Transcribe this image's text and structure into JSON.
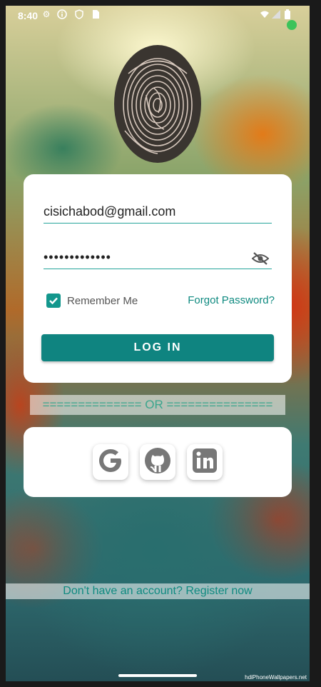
{
  "status_bar": {
    "time": "8:40",
    "left_icons": [
      "settings-icon",
      "info-icon",
      "shield-icon",
      "sim-icon"
    ],
    "right_icons": [
      "wifi-icon",
      "signal-icon",
      "battery-icon"
    ],
    "indicator_color": "#3cc35a"
  },
  "login": {
    "email_value": "cisichabod@gmail.com",
    "password_value": "•••••••••••••",
    "remember_label": "Remember Me",
    "remember_checked": true,
    "forgot_label": "Forgot Password?",
    "login_button_label": "LOG IN"
  },
  "divider": {
    "text": "============== OR ==============="
  },
  "social": {
    "buttons": [
      {
        "name": "google",
        "icon": "google-icon"
      },
      {
        "name": "github",
        "icon": "github-icon"
      },
      {
        "name": "linkedin",
        "icon": "linkedin-icon"
      }
    ]
  },
  "register": {
    "label": "Don't have an account? Register now"
  },
  "watermark": "hdiPhoneWallpapers.net",
  "colors": {
    "accent": "#0f8480",
    "link": "#0f8a80",
    "divider_text": "#3aa58d"
  }
}
